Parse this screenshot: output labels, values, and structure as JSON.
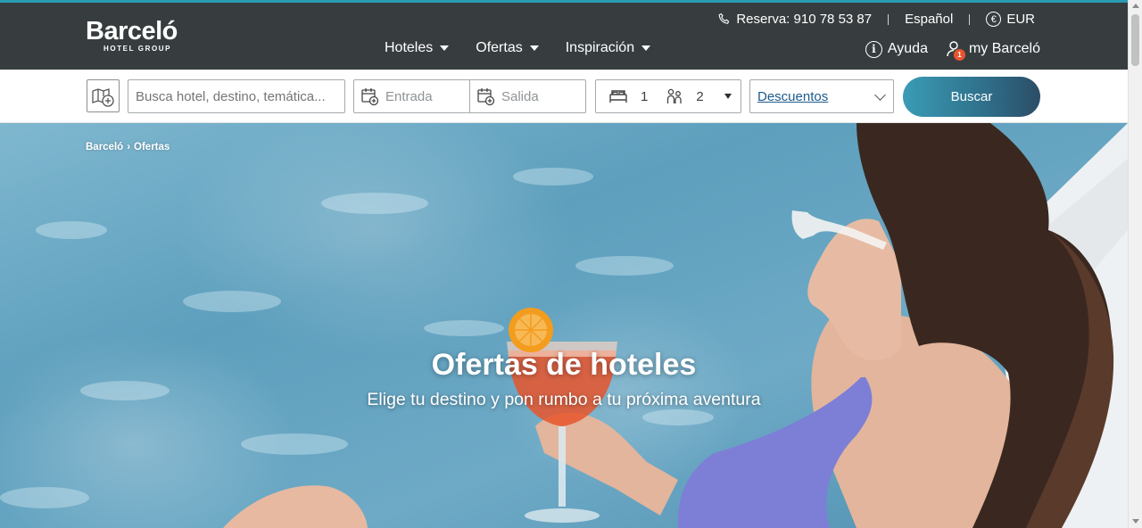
{
  "header": {
    "logo": {
      "name": "Barceló",
      "tagline": "HOTEL GROUP"
    },
    "phone": {
      "label": "Reserva: 910 78 53 87",
      "icon": "phone-icon"
    },
    "language": "Español",
    "currency": {
      "symbol": "€",
      "code": "EUR",
      "icon": "euro-icon"
    },
    "nav": [
      {
        "label": "Hoteles"
      },
      {
        "label": "Ofertas"
      },
      {
        "label": "Inspiración"
      }
    ],
    "help": {
      "label": "Ayuda",
      "icon": "info-icon"
    },
    "account": {
      "label": "my Barceló",
      "badge": "1",
      "icon": "user-icon"
    }
  },
  "search": {
    "map_button_icon": "map-plus-icon",
    "destination_placeholder": "Busca hotel, destino, temática...",
    "checkin_placeholder": "Entrada",
    "checkout_placeholder": "Salida",
    "rooms": "1",
    "guests": "2",
    "discounts_label": "Descuentos",
    "submit_label": "Buscar"
  },
  "breadcrumb": [
    "Barceló",
    "›",
    "Ofertas"
  ],
  "hero": {
    "title": "Ofertas de hoteles",
    "subtitle": "Elige tu destino y pon rumbo a tu próxima aventura"
  },
  "colors": {
    "header_bg": "#373d3f",
    "accent_teal": "#2a9bb3",
    "button_gradient_start": "#3a9cb5",
    "button_gradient_end": "#2c4d66",
    "link_blue": "#1d5a8c",
    "badge_orange": "#e8542e"
  }
}
